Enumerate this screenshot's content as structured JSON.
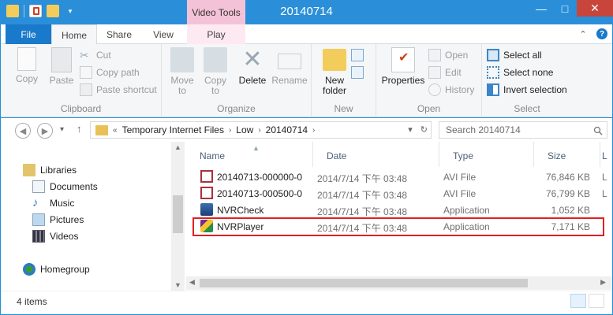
{
  "window": {
    "title": "20140714",
    "context_tab_group": "Video Tools",
    "minimize": "—",
    "maximize": "□",
    "close": "✕"
  },
  "ribbon_tabs": [
    {
      "label": "File"
    },
    {
      "label": "Home"
    },
    {
      "label": "Share"
    },
    {
      "label": "View"
    },
    {
      "label": "Play"
    }
  ],
  "ribbon": {
    "clipboard": {
      "label": "Clipboard",
      "copy": "Copy",
      "paste": "Paste",
      "cut": "Cut",
      "copy_path": "Copy path",
      "paste_shortcut": "Paste shortcut"
    },
    "organize": {
      "label": "Organize",
      "move_to": "Move to",
      "copy_to": "Copy to",
      "delete": "Delete",
      "rename": "Rename"
    },
    "new": {
      "label": "New",
      "new_folder": "New folder"
    },
    "open": {
      "label": "Open",
      "properties": "Properties",
      "open": "Open",
      "edit": "Edit",
      "history": "History"
    },
    "select": {
      "label": "Select",
      "select_all": "Select all",
      "select_none": "Select none",
      "invert_selection": "Invert selection"
    }
  },
  "address": {
    "prefix": "«",
    "crumbs": [
      "Temporary Internet Files",
      "Low",
      "20140714"
    ],
    "separator": "›"
  },
  "search": {
    "placeholder": "Search 20140714"
  },
  "navpane": {
    "libraries": "Libraries",
    "documents": "Documents",
    "music": "Music",
    "pictures": "Pictures",
    "videos": "Videos",
    "homegroup": "Homegroup"
  },
  "columns": {
    "name": "Name",
    "date": "Date",
    "type": "Type",
    "size": "Size",
    "extra": "L"
  },
  "files": [
    {
      "name": "20140713-000000-0...",
      "date": "2014/7/14 下午 03:48",
      "type": "AVI File",
      "size": "76,846 KB",
      "extra": "L"
    },
    {
      "name": "20140713-000500-0...",
      "date": "2014/7/14 下午 03:48",
      "type": "AVI File",
      "size": "76,799 KB",
      "extra": "L"
    },
    {
      "name": "NVRCheck",
      "date": "2014/7/14 下午 03:48",
      "type": "Application",
      "size": "1,052 KB",
      "extra": ""
    },
    {
      "name": "NVRPlayer",
      "date": "2014/7/14 下午 03:48",
      "type": "Application",
      "size": "7,171 KB",
      "extra": ""
    }
  ],
  "status": {
    "item_count": "4 items"
  },
  "colors": {
    "accent": "#1979ca",
    "title_bar": "#2a8fd8",
    "highlight_box": "#e02020"
  }
}
